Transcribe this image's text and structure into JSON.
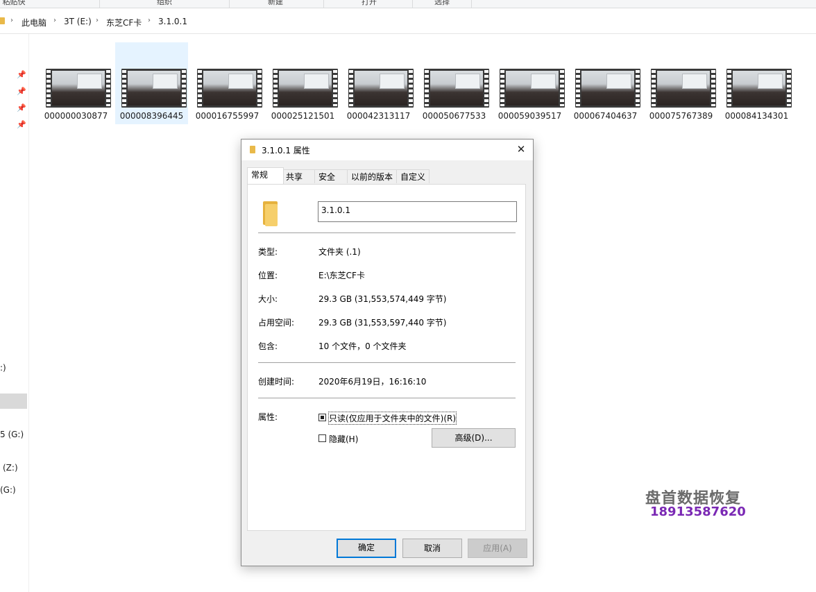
{
  "ribbon": {
    "groups": [
      "粘贴快捷方式",
      "组织",
      "新建",
      "打开",
      "选择"
    ]
  },
  "address": {
    "crumbs": [
      "此电脑",
      "3T (E:)",
      "东芝CF卡",
      "3.1.0.1"
    ]
  },
  "nav": {
    "labels": [
      ":)",
      "5 (G:)",
      "(Z:)",
      "(G:)"
    ]
  },
  "files": [
    "000000030877",
    "000008396445",
    "000016755997",
    "000025121501",
    "000042313117",
    "000050677533",
    "000059039517",
    "000067404637",
    "000075767389",
    "000084134301"
  ],
  "dialog": {
    "title": "3.1.0.1 属性",
    "close": "✕",
    "tabs": [
      "常规",
      "共享",
      "安全",
      "以前的版本",
      "自定义"
    ],
    "name_value": "3.1.0.1",
    "type_label": "类型:",
    "type_value": "文件夹 (.1)",
    "location_label": "位置:",
    "location_value": "E:\\东芝CF卡",
    "size_label": "大小:",
    "size_value": "29.3 GB (31,553,574,449 字节)",
    "disk_label": "占用空间:",
    "disk_value": "29.3 GB (31,553,597,440 字节)",
    "contains_label": "包含:",
    "contains_value": "10 个文件，0 个文件夹",
    "created_label": "创建时间:",
    "created_value": "2020年6月19日，16:16:10",
    "attr_label": "属性:",
    "readonly_label": "只读(仅应用于文件夹中的文件)(R)",
    "hidden_label": "隐藏(H)",
    "advanced_label": "高级(D)...",
    "ok_label": "确定",
    "cancel_label": "取消",
    "apply_label": "应用(A)"
  },
  "watermark": {
    "line1": "盘首数据恢复",
    "line2": "18913587620"
  }
}
